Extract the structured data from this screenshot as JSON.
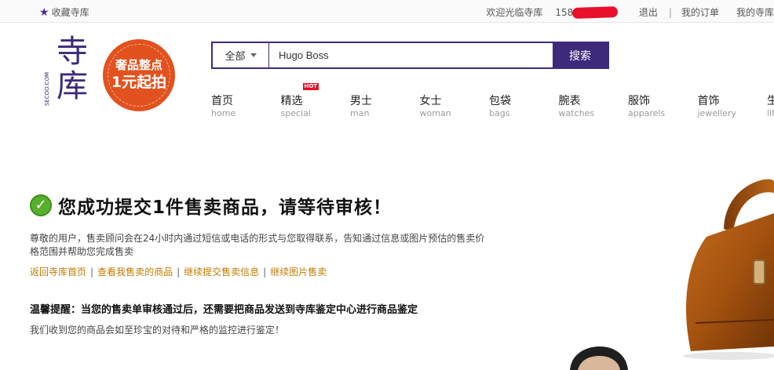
{
  "topbar": {
    "favorite": "收藏寺库",
    "welcome": "欢迎光临寺库",
    "phone_prefix": "1580",
    "logout": "退出",
    "separator": "|",
    "my_orders": "我的订单",
    "my_secoo": "我的寺库"
  },
  "logo": {
    "text": "寺库",
    "domain": "SECOO.COM"
  },
  "promo": {
    "line1": "奢品整点",
    "line2": "1元起拍"
  },
  "search": {
    "category": "全部",
    "value": "Hugo Boss",
    "button": "搜索"
  },
  "nav": {
    "hot_badge": "HOT",
    "items": [
      {
        "cn": "首页",
        "en": "home"
      },
      {
        "cn": "精选",
        "en": "special"
      },
      {
        "cn": "男士",
        "en": "man"
      },
      {
        "cn": "女士",
        "en": "woman"
      },
      {
        "cn": "包袋",
        "en": "bags"
      },
      {
        "cn": "腕表",
        "en": "watches"
      },
      {
        "cn": "服饰",
        "en": "apparels"
      },
      {
        "cn": "首饰",
        "en": "jewellery"
      },
      {
        "cn": "生",
        "en": "lif"
      }
    ]
  },
  "message": {
    "title": "您成功提交1件售卖商品，请等待审核！",
    "desc": "尊敬的用户，售卖顾问会在24小时内通过短信或电话的形式与您取得联系，告知通过信息或图片预估的售卖价格范围并帮助您完成售卖",
    "links": [
      "返回寺库首页",
      "查看我售卖的商品",
      "继续提交售卖信息",
      "继续图片售卖"
    ],
    "link_separator": "|",
    "tip_title": "温馨提醒：当您的售卖单审核通过后，还需要把商品发送到寺库鉴定中心进行商品鉴定",
    "tip_desc": "我们收到您的商品会如至珍宝的对待和严格的监控进行鉴定！"
  },
  "colors": {
    "brand": "#3d2a7a",
    "promo": "#e2521e",
    "link": "#c17a00",
    "success": "#58b02e",
    "hot": "#e8102a"
  }
}
